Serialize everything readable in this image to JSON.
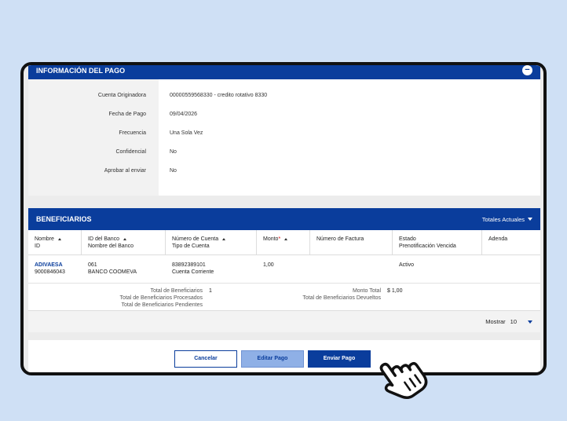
{
  "payment_info": {
    "title": "INFORMACIÓN DEL PAGO",
    "collapse_icon": "minus-circle-icon",
    "rows": [
      {
        "label": "Cuenta Originadora",
        "value": "00000559568330 - credito rotativo 8330"
      },
      {
        "label": "Fecha de Pago",
        "value": "09/04/2026"
      },
      {
        "label": "Frecuencia",
        "value": "Una Sola Vez"
      },
      {
        "label": "Confidencial",
        "value": "No"
      },
      {
        "label": "Aprobar al enviar",
        "value": "No"
      }
    ]
  },
  "beneficiaries": {
    "title": "BENEFICIARIOS",
    "totals_dropdown": "Totales Actuales",
    "columns": [
      {
        "line1": "Nombre",
        "line2": "ID"
      },
      {
        "line1": "ID del Banco",
        "line2": "Nombre del Banco"
      },
      {
        "line1": "Número de Cuenta",
        "line2": "Tipo de Cuenta"
      },
      {
        "line1": "Monto",
        "line2": ""
      },
      {
        "line1": "Número de Factura",
        "line2": ""
      },
      {
        "line1": "Estado",
        "line2": "Prenotificación Vencida"
      },
      {
        "line1": "Adenda",
        "line2": ""
      }
    ],
    "rows": [
      {
        "name": "ADIVAESA",
        "id": "9000846043",
        "bank_id": "061",
        "bank_name": "BANCO COOMEVA",
        "account": "83892389101",
        "account_type": "Cuenta Corriente",
        "amount": "1,00",
        "invoice": "",
        "status": "Activo"
      }
    ],
    "summary": {
      "total_label": "Total de Beneficiarios",
      "total_value": "1",
      "processed_label": "Total de Beneficiarios Procesados",
      "pending_label": "Total de Beneficiarios Pendientes",
      "amount_label": "Monto Total",
      "amount_value": "$ 1,00",
      "returned_label": "Total de Beneficiarios Devueltos"
    },
    "show_label": "Mostrar",
    "show_value": "10"
  },
  "actions": {
    "cancel": "Cancelar",
    "edit": "Editar Pago",
    "send": "Enviar Pago"
  },
  "colors": {
    "primary": "#0a3d9c",
    "background": "#cfe0f5",
    "disabled_button": "#8fb0e6"
  }
}
